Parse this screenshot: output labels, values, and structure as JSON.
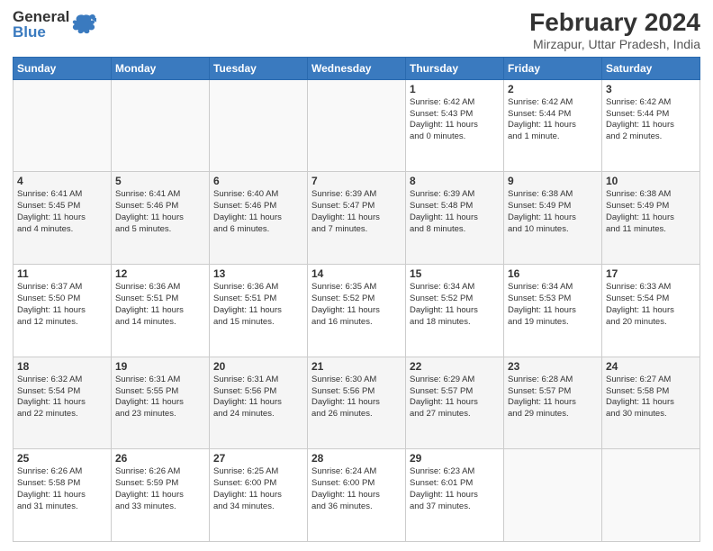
{
  "logo": {
    "general": "General",
    "blue": "Blue"
  },
  "title": "February 2024",
  "subtitle": "Mirzapur, Uttar Pradesh, India",
  "days_of_week": [
    "Sunday",
    "Monday",
    "Tuesday",
    "Wednesday",
    "Thursday",
    "Friday",
    "Saturday"
  ],
  "weeks": [
    [
      {
        "day": "",
        "info": ""
      },
      {
        "day": "",
        "info": ""
      },
      {
        "day": "",
        "info": ""
      },
      {
        "day": "",
        "info": ""
      },
      {
        "day": "1",
        "info": "Sunrise: 6:42 AM\nSunset: 5:43 PM\nDaylight: 11 hours\nand 0 minutes."
      },
      {
        "day": "2",
        "info": "Sunrise: 6:42 AM\nSunset: 5:44 PM\nDaylight: 11 hours\nand 1 minute."
      },
      {
        "day": "3",
        "info": "Sunrise: 6:42 AM\nSunset: 5:44 PM\nDaylight: 11 hours\nand 2 minutes."
      }
    ],
    [
      {
        "day": "4",
        "info": "Sunrise: 6:41 AM\nSunset: 5:45 PM\nDaylight: 11 hours\nand 4 minutes."
      },
      {
        "day": "5",
        "info": "Sunrise: 6:41 AM\nSunset: 5:46 PM\nDaylight: 11 hours\nand 5 minutes."
      },
      {
        "day": "6",
        "info": "Sunrise: 6:40 AM\nSunset: 5:46 PM\nDaylight: 11 hours\nand 6 minutes."
      },
      {
        "day": "7",
        "info": "Sunrise: 6:39 AM\nSunset: 5:47 PM\nDaylight: 11 hours\nand 7 minutes."
      },
      {
        "day": "8",
        "info": "Sunrise: 6:39 AM\nSunset: 5:48 PM\nDaylight: 11 hours\nand 8 minutes."
      },
      {
        "day": "9",
        "info": "Sunrise: 6:38 AM\nSunset: 5:49 PM\nDaylight: 11 hours\nand 10 minutes."
      },
      {
        "day": "10",
        "info": "Sunrise: 6:38 AM\nSunset: 5:49 PM\nDaylight: 11 hours\nand 11 minutes."
      }
    ],
    [
      {
        "day": "11",
        "info": "Sunrise: 6:37 AM\nSunset: 5:50 PM\nDaylight: 11 hours\nand 12 minutes."
      },
      {
        "day": "12",
        "info": "Sunrise: 6:36 AM\nSunset: 5:51 PM\nDaylight: 11 hours\nand 14 minutes."
      },
      {
        "day": "13",
        "info": "Sunrise: 6:36 AM\nSunset: 5:51 PM\nDaylight: 11 hours\nand 15 minutes."
      },
      {
        "day": "14",
        "info": "Sunrise: 6:35 AM\nSunset: 5:52 PM\nDaylight: 11 hours\nand 16 minutes."
      },
      {
        "day": "15",
        "info": "Sunrise: 6:34 AM\nSunset: 5:52 PM\nDaylight: 11 hours\nand 18 minutes."
      },
      {
        "day": "16",
        "info": "Sunrise: 6:34 AM\nSunset: 5:53 PM\nDaylight: 11 hours\nand 19 minutes."
      },
      {
        "day": "17",
        "info": "Sunrise: 6:33 AM\nSunset: 5:54 PM\nDaylight: 11 hours\nand 20 minutes."
      }
    ],
    [
      {
        "day": "18",
        "info": "Sunrise: 6:32 AM\nSunset: 5:54 PM\nDaylight: 11 hours\nand 22 minutes."
      },
      {
        "day": "19",
        "info": "Sunrise: 6:31 AM\nSunset: 5:55 PM\nDaylight: 11 hours\nand 23 minutes."
      },
      {
        "day": "20",
        "info": "Sunrise: 6:31 AM\nSunset: 5:56 PM\nDaylight: 11 hours\nand 24 minutes."
      },
      {
        "day": "21",
        "info": "Sunrise: 6:30 AM\nSunset: 5:56 PM\nDaylight: 11 hours\nand 26 minutes."
      },
      {
        "day": "22",
        "info": "Sunrise: 6:29 AM\nSunset: 5:57 PM\nDaylight: 11 hours\nand 27 minutes."
      },
      {
        "day": "23",
        "info": "Sunrise: 6:28 AM\nSunset: 5:57 PM\nDaylight: 11 hours\nand 29 minutes."
      },
      {
        "day": "24",
        "info": "Sunrise: 6:27 AM\nSunset: 5:58 PM\nDaylight: 11 hours\nand 30 minutes."
      }
    ],
    [
      {
        "day": "25",
        "info": "Sunrise: 6:26 AM\nSunset: 5:58 PM\nDaylight: 11 hours\nand 31 minutes."
      },
      {
        "day": "26",
        "info": "Sunrise: 6:26 AM\nSunset: 5:59 PM\nDaylight: 11 hours\nand 33 minutes."
      },
      {
        "day": "27",
        "info": "Sunrise: 6:25 AM\nSunset: 6:00 PM\nDaylight: 11 hours\nand 34 minutes."
      },
      {
        "day": "28",
        "info": "Sunrise: 6:24 AM\nSunset: 6:00 PM\nDaylight: 11 hours\nand 36 minutes."
      },
      {
        "day": "29",
        "info": "Sunrise: 6:23 AM\nSunset: 6:01 PM\nDaylight: 11 hours\nand 37 minutes."
      },
      {
        "day": "",
        "info": ""
      },
      {
        "day": "",
        "info": ""
      }
    ]
  ]
}
